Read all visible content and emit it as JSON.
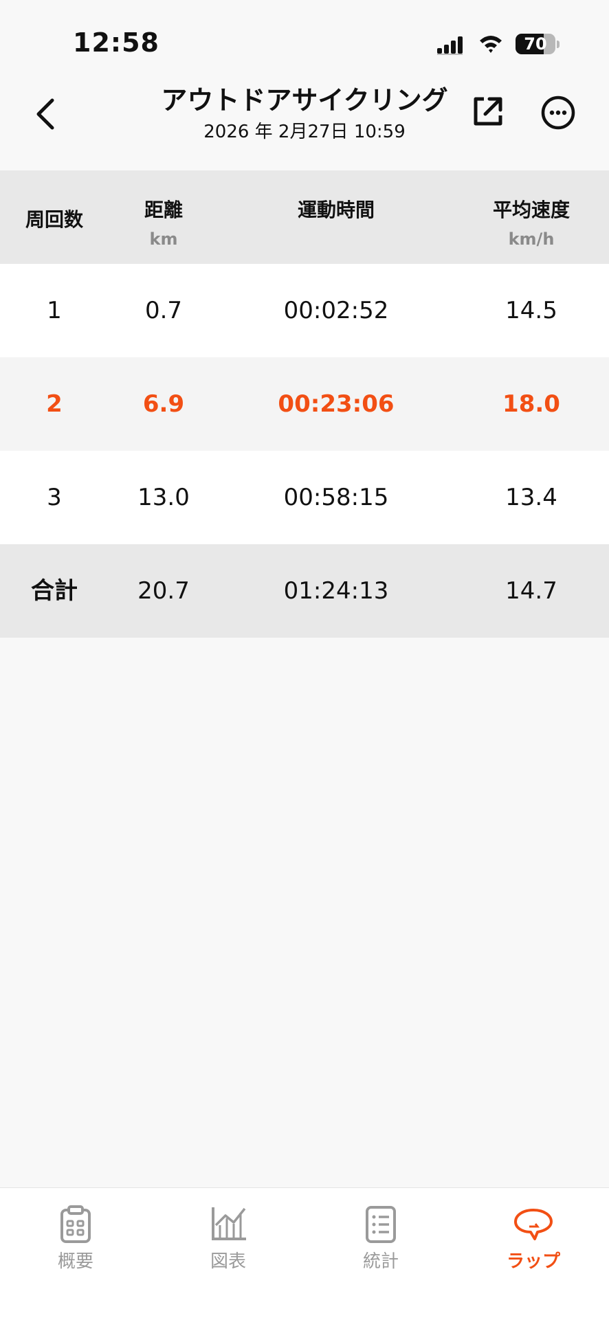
{
  "status_bar": {
    "time": "12:58",
    "battery_percent": 70,
    "battery_text": "70"
  },
  "header": {
    "title": "アウトドアサイクリング",
    "subtitle": "2026 年 2月27日 10:59",
    "back_icon": "chevron-left-icon",
    "share_icon": "share-icon",
    "more_icon": "more-icon"
  },
  "table": {
    "columns": [
      {
        "label": "周回数",
        "unit": ""
      },
      {
        "label": "距離",
        "unit": "km"
      },
      {
        "label": "運動時間",
        "unit": ""
      },
      {
        "label": "平均速度",
        "unit": "km/h"
      }
    ],
    "rows": [
      {
        "lap": "1",
        "distance": "0.7",
        "time": "00:02:52",
        "speed": "14.5",
        "highlight": false
      },
      {
        "lap": "2",
        "distance": "6.9",
        "time": "00:23:06",
        "speed": "18.0",
        "highlight": true
      },
      {
        "lap": "3",
        "distance": "13.0",
        "time": "00:58:15",
        "speed": "13.4",
        "highlight": false
      }
    ],
    "total": {
      "lap": "合計",
      "distance": "20.7",
      "time": "01:24:13",
      "speed": "14.7"
    }
  },
  "tabs": [
    {
      "label": "概要",
      "icon": "clipboard-icon",
      "active": false
    },
    {
      "label": "図表",
      "icon": "chart-icon",
      "active": false
    },
    {
      "label": "統計",
      "icon": "list-icon",
      "active": false
    },
    {
      "label": "ラップ",
      "icon": "lap-bubble-icon",
      "active": true
    }
  ],
  "colors": {
    "accent": "#f24f14",
    "header_bg": "#e8e8e8",
    "inactive_tab": "#9a9a9a"
  }
}
